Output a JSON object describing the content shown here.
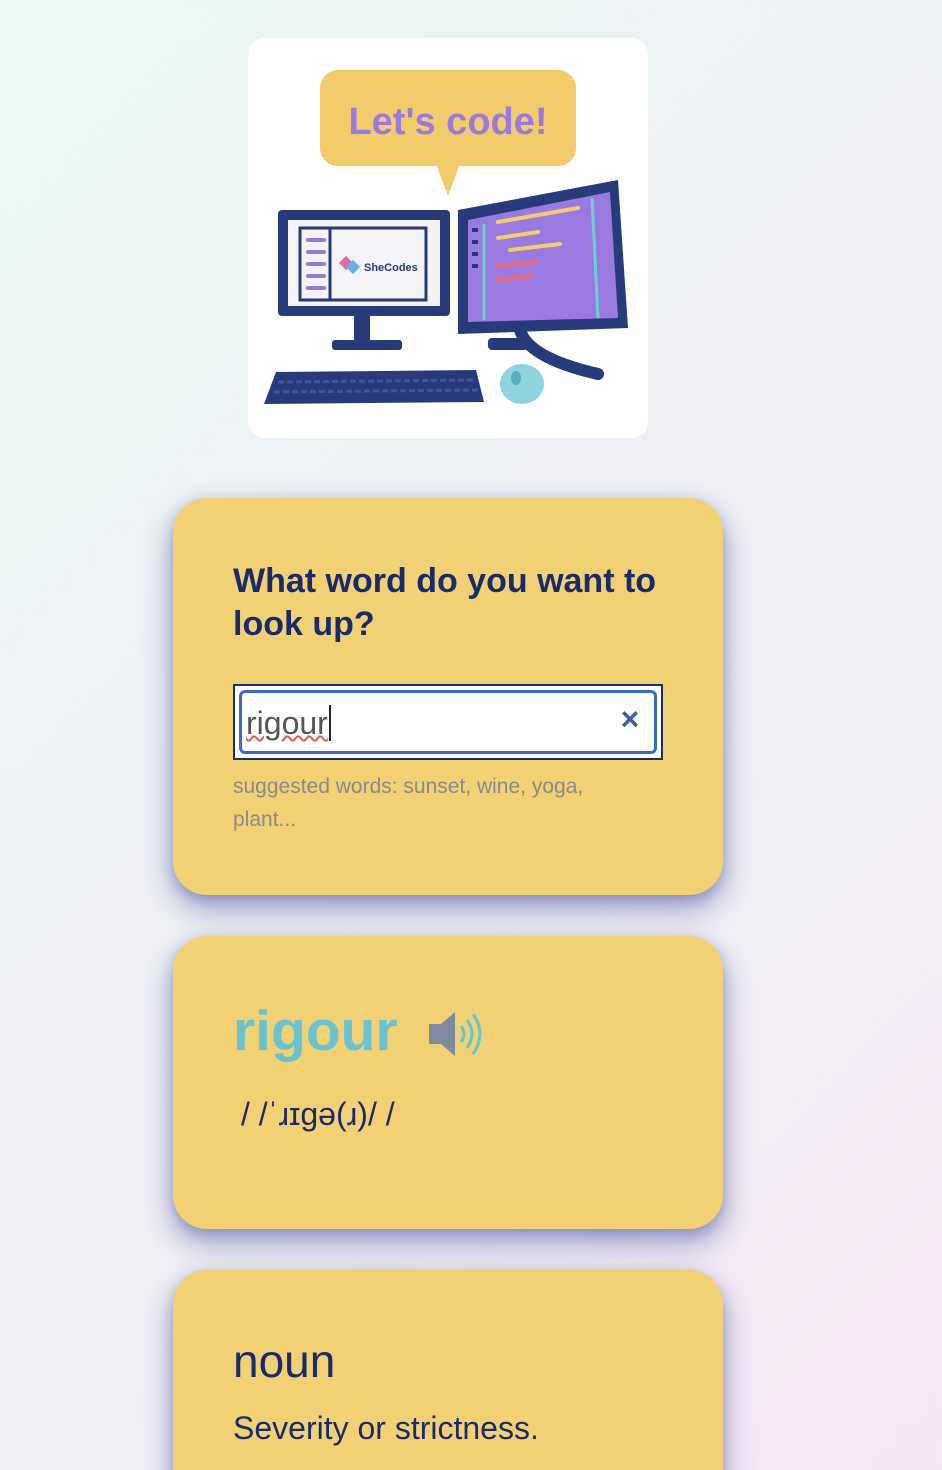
{
  "hero": {
    "speech_bubble": "Let's code!",
    "screen_brand": "SheCodes"
  },
  "search": {
    "question": "What word do you want to look up?",
    "input_value": "rigour",
    "clear_icon": "×",
    "hint": "suggested words: sunset, wine, yoga, plant..."
  },
  "result": {
    "word": "rigour",
    "speaker_icon": "speaker-icon",
    "phonetic": "/ /ˈɹɪɡə(ɹ)/ /"
  },
  "meaning": {
    "part_of_speech": "noun",
    "definition": "Severity or strictness."
  },
  "colors": {
    "card": "#f2d175",
    "heading": "#1a2b6b",
    "word": "#6cc3d0",
    "hint": "#8a8a8a"
  }
}
